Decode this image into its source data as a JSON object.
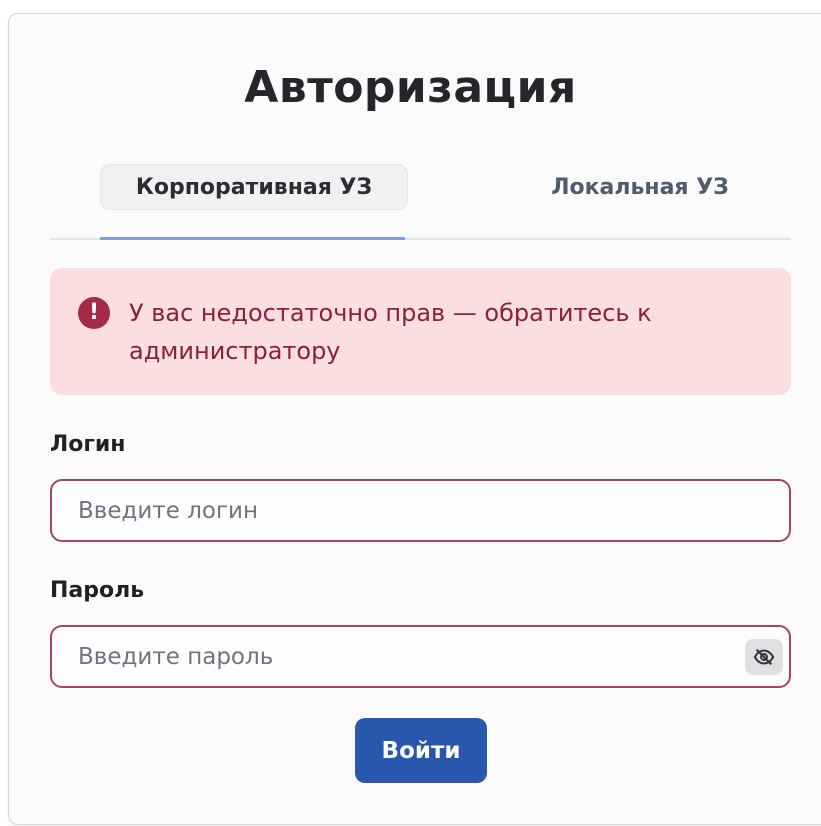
{
  "title": "Авторизация",
  "tabs": [
    {
      "label": "Корпоративная УЗ",
      "active": true
    },
    {
      "label": "Локальная УЗ",
      "active": false
    }
  ],
  "alert": {
    "icon": "exclamation-circle-icon",
    "message": "У вас недостаточно прав — обратитесь к администратору"
  },
  "login": {
    "label": "Логин",
    "value": "",
    "placeholder": "Введите логин"
  },
  "password": {
    "label": "Пароль",
    "value": "",
    "placeholder": "Введите пароль",
    "toggle_icon": "eye-off-icon"
  },
  "submit_label": "Войти",
  "colors": {
    "accent": "#2957ad",
    "error": "#a52a45",
    "error_bg": "#fbdee0",
    "tab_underline": "#7f9ee0"
  }
}
